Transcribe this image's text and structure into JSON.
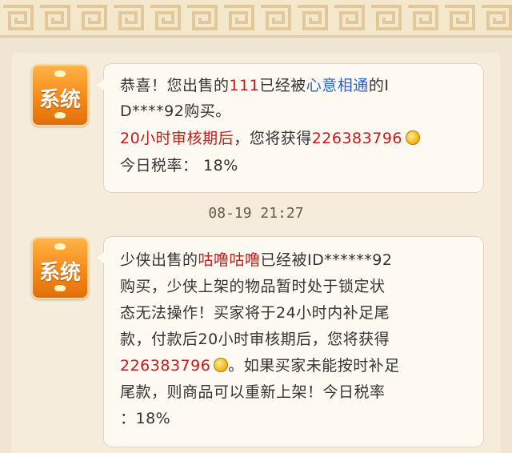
{
  "colors": {
    "accent_red": "#c01c1c",
    "accent_blue": "#2a5fcf",
    "avatar_orange": "#f48a18",
    "bubble_bg": "#fefaf1"
  },
  "messages": [
    {
      "sender_label": "系统",
      "lines": [
        [
          "恭喜！您出售的",
          "111",
          "已经被",
          "心意相通",
          "的I"
        ],
        [
          "D****92购买。"
        ],
        [
          "20小时审核期后",
          "，您将获得",
          "226383796"
        ],
        [
          "今日税率：  18%"
        ]
      ]
    },
    {
      "sender_label": "系统",
      "lines": [
        [
          "少侠出售的",
          "咕噜咕噜",
          "已经被ID******92"
        ],
        [
          "购买，少侠上架的物品暂时处于锁定状"
        ],
        [
          "态无法操作！买家将于24小时内补足尾"
        ],
        [
          "款，付款后20小时审核期后，您将获得"
        ],
        [
          "226383796",
          "。如果买家未能按时补足"
        ],
        [
          "尾款，则商品可以重新上架！今日税率"
        ],
        [
          "：18%"
        ]
      ]
    }
  ],
  "timestamp": "08-19  21:27",
  "icons": {
    "currency": "gold-coin-icon",
    "avatar": "system-avatar-icon"
  }
}
